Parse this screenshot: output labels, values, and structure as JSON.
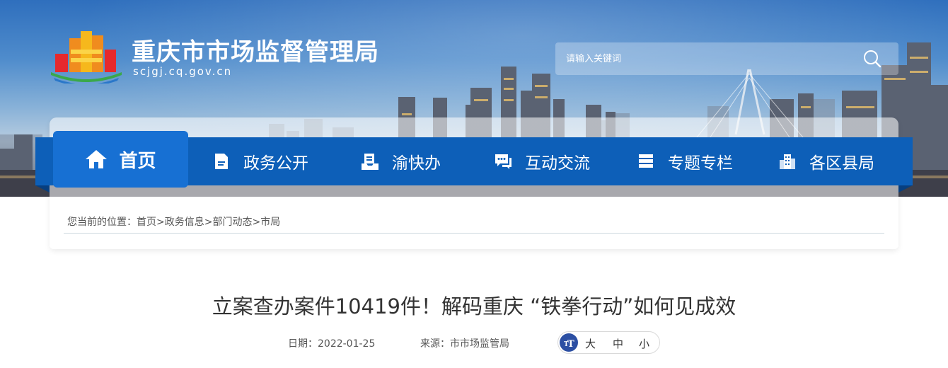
{
  "header": {
    "site_title": "重庆市市场监督管理局",
    "site_domain": "scjgj.cq.gov.cn",
    "search_placeholder": "请输入关键词"
  },
  "nav": {
    "items": [
      {
        "label": "首页",
        "icon": "home-icon",
        "active": true
      },
      {
        "label": "政务公开",
        "icon": "document-icon"
      },
      {
        "label": "渝快办",
        "icon": "inbox-icon"
      },
      {
        "label": "互动交流",
        "icon": "chat-icon"
      },
      {
        "label": "专题专栏",
        "icon": "stack-icon"
      },
      {
        "label": "各区县局",
        "icon": "buildings-icon"
      }
    ]
  },
  "breadcrumb": {
    "prefix": "您当前的位置：",
    "items": [
      "首页",
      "政务信息",
      "部门动态",
      "市局"
    ],
    "separator": ">"
  },
  "article": {
    "title": "立案查办案件10419件！解码重庆 “铁拳行动”如何见成效",
    "date_label": "日期：",
    "date": "2022-01-25",
    "source_label": "来源：",
    "source": "市市场监管局",
    "font_size_options": [
      "大",
      "中",
      "小"
    ]
  },
  "colors": {
    "nav_bg": "#0d5fb8",
    "nav_active_bg": "#1770d3",
    "text": "#333333",
    "font_icon_bg": "#2c4fa3"
  }
}
